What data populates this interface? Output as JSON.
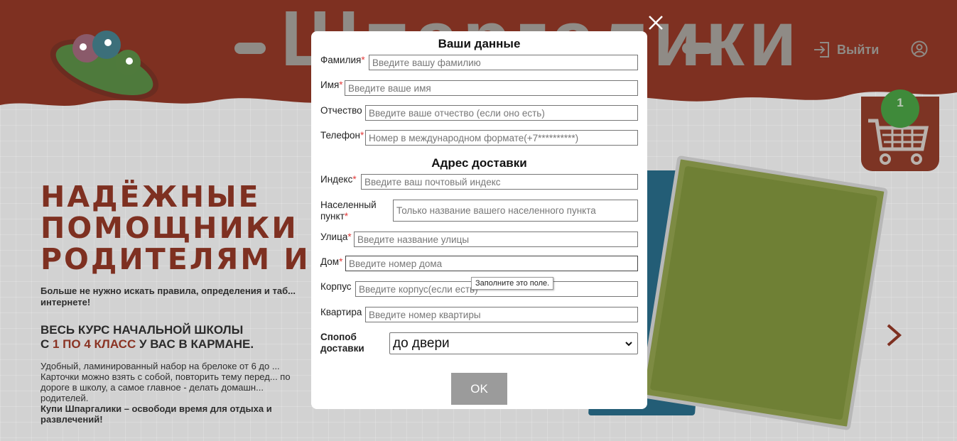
{
  "background": {
    "logo_text": "Шпаргалики",
    "logout_label": "Выйти",
    "cart_count": "1",
    "hero_title_lines": [
      "НАДЁЖНЫЕ",
      "ПОМОЩНИКИ",
      "РОДИТЕЛЯМ И ..."
    ],
    "hero_paragraph": "Больше не нужно искать правила, определения и таб... интернете!",
    "hero_h2_line1": "ВЕСЬ КУРС НАЧАЛЬНОЙ ШКОЛЫ",
    "hero_h2_prefix": "С ",
    "hero_h2_accent": "1 ПО 4 КЛАСС",
    "hero_h2_suffix": " У ВАС В КАРМАНЕ.",
    "hero_small_text": "Удобный, ламинированный набор на брелоке от 6 до ... Карточки можно взять с собой, повторить тему перед... по дороге в школу, а самое главное - делать домашн... родителей.",
    "hero_small_bold": "Купи Шпаргалики – освободи время для отдыха и развлечений!"
  },
  "modal": {
    "section1_title": "Ваши данные",
    "section2_title": "Адрес доставки",
    "fields": {
      "last_name": {
        "label": "Фамилия",
        "required": "*",
        "placeholder": "Введите вашу фамилию"
      },
      "first_name": {
        "label": "Имя",
        "required": "*",
        "placeholder": "Введите ваше имя"
      },
      "patronymic": {
        "label": "Отчество",
        "required": "",
        "placeholder": "Введите ваше отчество (если оно есть)"
      },
      "phone": {
        "label": "Телефон",
        "required": "*",
        "placeholder": "Номер в международном формате(+7**********)"
      },
      "index": {
        "label": "Индекс",
        "required": "*",
        "placeholder": "Введите ваш почтовый индекс"
      },
      "city": {
        "label_line1": "Населенный",
        "label_line2": "пункт",
        "required": "*",
        "placeholder": "Только название вашего населенного пункта"
      },
      "street": {
        "label": "Улица",
        "required": "*",
        "placeholder": "Введите название улицы"
      },
      "house": {
        "label": "Дом",
        "required": "*",
        "placeholder": "Введите номер дома"
      },
      "building": {
        "label": "Корпус",
        "required": "",
        "placeholder": "Введите корпус(если есть)"
      },
      "apartment": {
        "label": "Квартира",
        "required": "",
        "placeholder": "Введите номер квартиры"
      }
    },
    "delivery": {
      "label_line1": "Спопоб",
      "label_line2": "доставки",
      "selected": "до двери"
    },
    "ok_label": "OK",
    "tooltip": "Заполните это поле."
  },
  "colors": {
    "brand_red": "#7e3021",
    "required_star": "#e23a3a",
    "ok_button": "#9b9b9b"
  }
}
